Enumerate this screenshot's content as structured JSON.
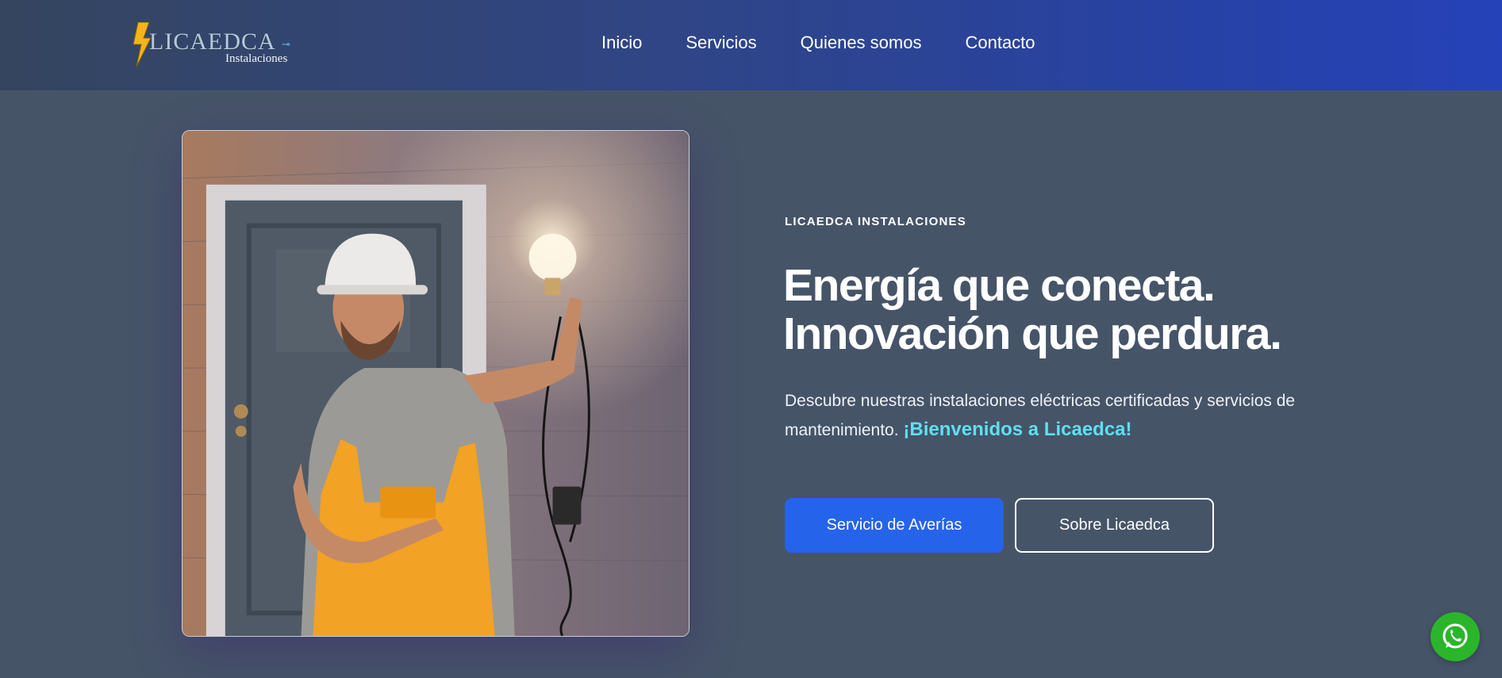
{
  "header": {
    "logo": {
      "brand": "LICAEDCA",
      "subtitle": "Instalaciones"
    },
    "nav": [
      {
        "label": "Inicio"
      },
      {
        "label": "Servicios"
      },
      {
        "label": "Quienes somos"
      },
      {
        "label": "Contacto"
      }
    ]
  },
  "hero": {
    "image_alt": "electrician-holding-lightbulb",
    "eyebrow": "LICAEDCA INSTALACIONES",
    "headline_line1": "Energía que conecta.",
    "headline_line2": "Innovación que perdura.",
    "description": "Descubre nuestras instalaciones eléctricas certificadas y servicios de mantenimiento.",
    "description_accent": "¡Bienvenidos a Licaedca!",
    "primary_button": "Servicio de Averías",
    "secondary_button": "Sobre Licaedca"
  },
  "floating": {
    "icon": "whatsapp-icon"
  },
  "colors": {
    "accent_blue": "#2563eb",
    "accent_cyan": "#5ce1f0",
    "background": "#465468",
    "whatsapp_green": "#2bb52b"
  }
}
